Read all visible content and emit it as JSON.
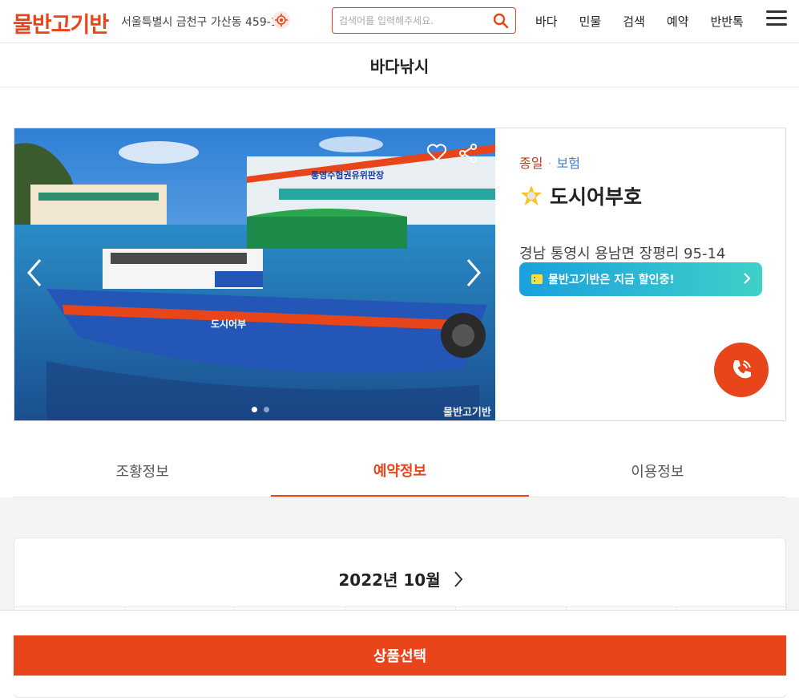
{
  "header": {
    "logo": "물반고기반",
    "location": "서울특별시 금천구 가산동 459-11",
    "search_placeholder": "검색어를 입력해주세요.",
    "nav": [
      "바다",
      "민물",
      "검색",
      "예약",
      "반반톡"
    ]
  },
  "page_title": "바다낚시",
  "listing": {
    "tag_primary": "종일",
    "tag_secondary": "보험",
    "name": "도시어부호",
    "address": "경남 통영시 용남면 장평리 95-14",
    "promo": "물반고기반은 지금 할인중!",
    "photo": {
      "building_sign": "통영수협권유위판장",
      "boat_label": "도시어부",
      "watermark": "물반고기반",
      "slide_count": 2,
      "current_slide": 1
    }
  },
  "tabs": [
    {
      "label": "조황정보",
      "active": false
    },
    {
      "label": "예약정보",
      "active": true
    },
    {
      "label": "이용정보",
      "active": false
    }
  ],
  "calendar": {
    "month_label": "2022년 10월"
  },
  "bottom": {
    "select_label": "상품선택"
  },
  "colors": {
    "brand": "#e8451b",
    "promo_start": "#1aa0de",
    "promo_end": "#3fd0c8",
    "tag_primary": "#b0421e",
    "tag_secondary": "#3d7fd1"
  }
}
